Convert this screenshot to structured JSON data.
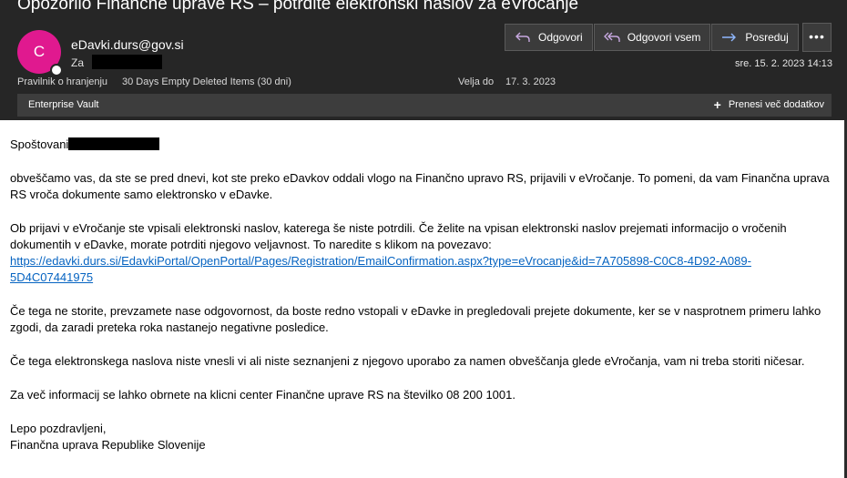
{
  "email": {
    "subject": "Opozorilo Finančne uprave RS – potrdite elektronski naslov za eVročanje",
    "avatar_initial": "C",
    "sender": "eDavki.durs@gov.si",
    "to_label": "Za",
    "date": "sre. 15. 2. 2023 14:13",
    "retention_label": "Pravilnik o hranjenju",
    "retention_value": "30 Days Empty Deleted Items (30 dni)",
    "expires_label": "Velja do",
    "expires_value": "17. 3. 2023",
    "actions": {
      "reply": "Odgovori",
      "reply_all": "Odgovori vsem",
      "forward": "Posreduj"
    },
    "more_label": "•••",
    "vault_label": "Enterprise Vault",
    "download_label": "Prenesi več dodatkov"
  },
  "body": {
    "greeting": "Spoštovani",
    "p1": "obveščamo vas, da ste se pred dnevi, kot ste preko eDavkov oddali vlogo na Finančno upravo RS, prijavili v eVročanje. To pomeni, da vam Finančna uprava RS vroča dokumente samo elektronsko v eDavke.",
    "p2": "Ob prijavi v eVročanje ste vpisali elektronski naslov, katerega še niste potrdili. Če želite na vpisan elektronski naslov prejemati informacijo o vročenih dokumentih v eDavke, morate potrditi njegovo veljavnost. To naredite s klikom na povezavo:",
    "link": "https://edavki.durs.si/EdavkiPortal/OpenPortal/Pages/Registration/EmailConfirmation.aspx?type=eVrocanje&id=7A705898-C0C8-4D92-A089-5D4C07441975",
    "p3": "Če tega ne storite, prevzamete nase odgovornost, da boste redno vstopali v eDavke in pregledovali prejete dokumente, ker se v nasprotnem primeru lahko zgodi, da zaradi preteka roka nastanejo negativne posledice.",
    "p4": "Če tega elektronskega naslova niste vnesli vi ali niste seznanjeni z njegovo uporabo za namen obveščanja glede eVročanja, vam ni treba storiti ničesar.",
    "p5": "Za več informacij se lahko obrnete na klicni center Finančne uprave RS na številko 08 200 1001.",
    "closing": "Lepo pozdravljeni,",
    "signature": "Finančna uprava Republike Slovenije"
  },
  "colors": {
    "header_bg": "#262626",
    "avatar": "#e0198f",
    "link": "#0563c1"
  }
}
